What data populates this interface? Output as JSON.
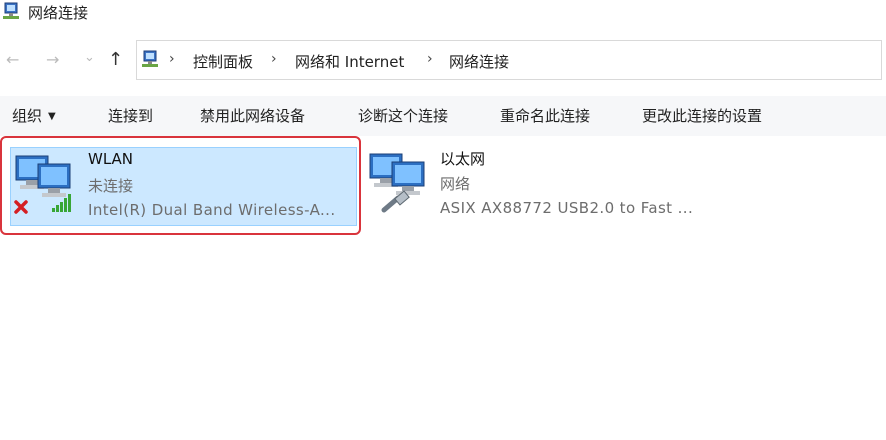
{
  "window": {
    "title": "网络连接"
  },
  "nav": {
    "back": "←",
    "forward": "→",
    "recent": "⌄",
    "up": "↑"
  },
  "breadcrumb": [
    "控制面板",
    "网络和 Internet",
    "网络连接"
  ],
  "toolbar": {
    "organize": "组织",
    "connect_to": "连接到",
    "disable": "禁用此网络设备",
    "diagnose": "诊断这个连接",
    "rename": "重命名此连接",
    "change_settings": "更改此连接的设置"
  },
  "connections": [
    {
      "name": "WLAN",
      "status": "未连接",
      "device": "Intel(R) Dual Band Wireless-A...",
      "icon": "wireless-network-icon",
      "selected": true
    },
    {
      "name": "以太网",
      "status": "网络",
      "device": "ASIX AX88772 USB2.0 to Fast ...",
      "icon": "ethernet-network-icon",
      "selected": false
    }
  ]
}
